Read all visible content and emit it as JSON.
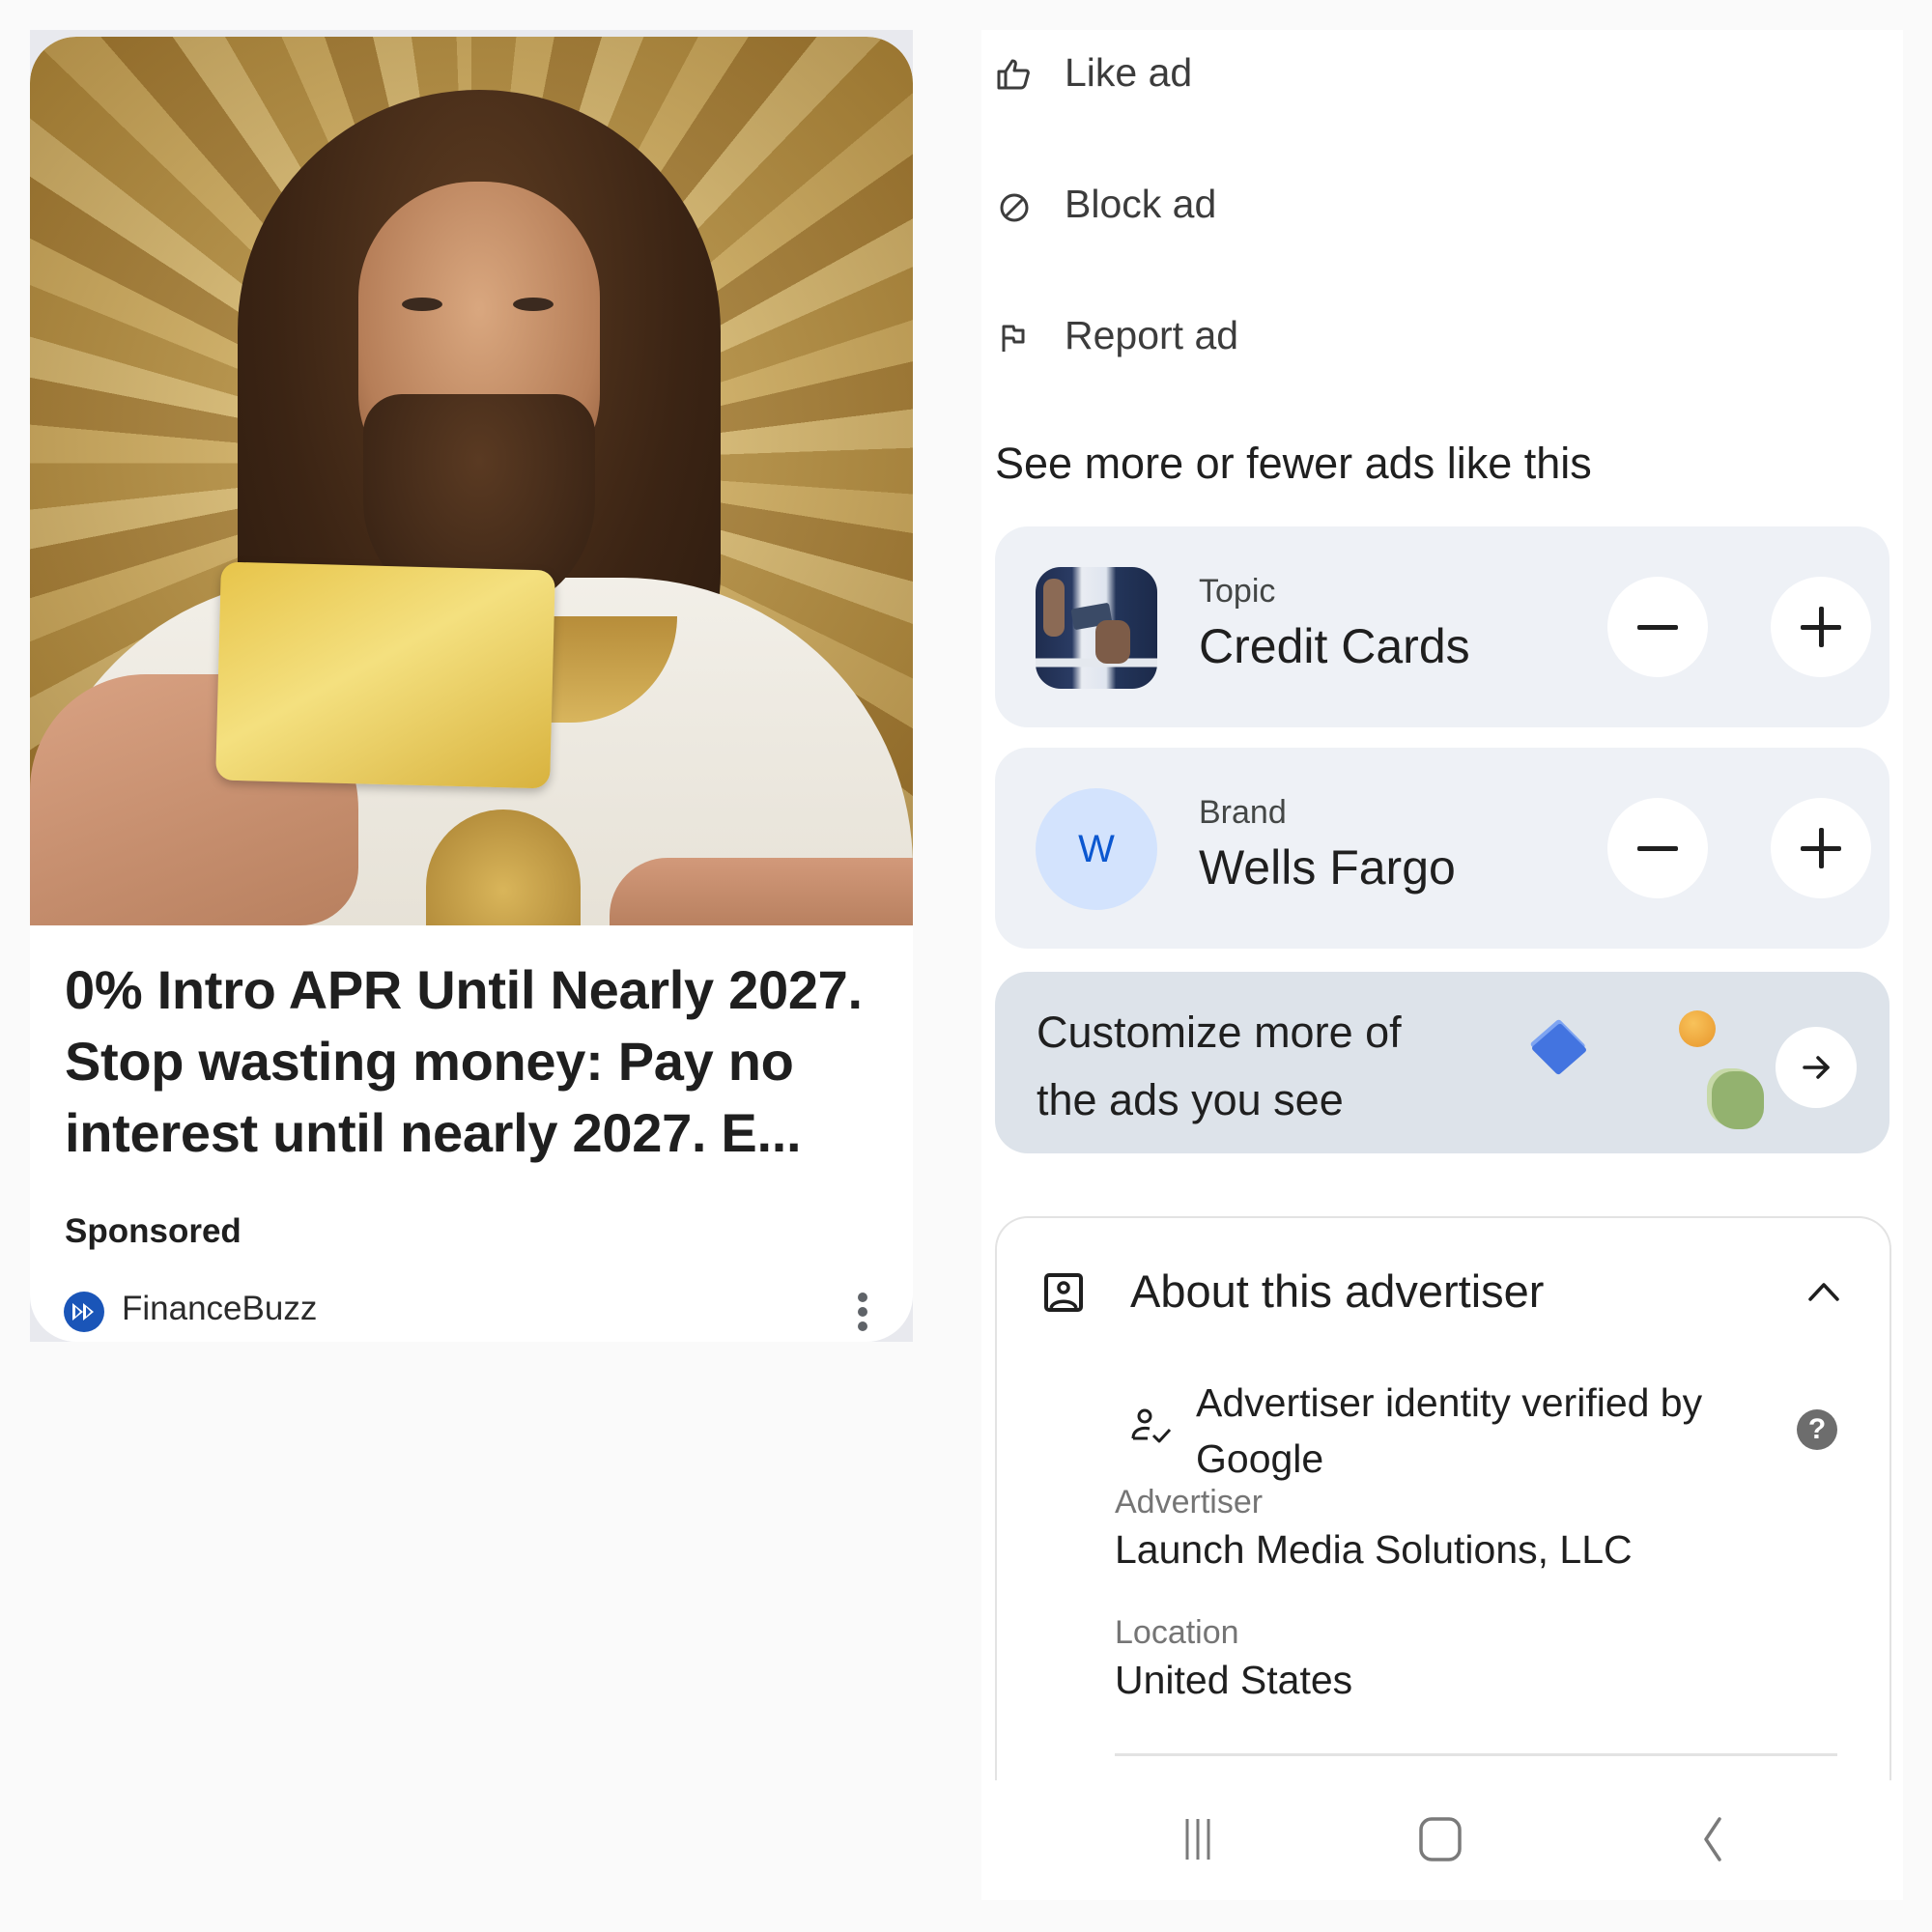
{
  "ad": {
    "image_alt": "Bearded man in white robe holding a gold credit card before a golden background",
    "headline": "0% Intro APR Until Nearly 2027. Stop wasting money: Pay no interest until nearly 2027. E...",
    "sponsored_label": "Sponsored",
    "advertiser_name": "FinanceBuzz",
    "logo_icon": "fast-forward-icon",
    "menu_icon": "more-vert-icon"
  },
  "actions": [
    {
      "label": "Like ad",
      "icon": "thumb-up-icon"
    },
    {
      "label": "Block ad",
      "icon": "block-icon"
    },
    {
      "label": "Report ad",
      "icon": "flag-icon"
    }
  ],
  "preferences": {
    "heading": "See more or fewer ads like this",
    "items": [
      {
        "kind": "Topic",
        "name": "Credit Cards",
        "thumb": "credit-card-photo"
      },
      {
        "kind": "Brand",
        "name": "Wells Fargo",
        "initial": "W"
      }
    ],
    "decrease_symbol": "minus-icon",
    "increase_symbol": "plus-icon"
  },
  "customize": {
    "text": "Customize more of the ads you see",
    "arrow_icon": "arrow-right-icon",
    "colors": {
      "diamond": "#4374e0",
      "circle": "#f0a53a",
      "blob": "#93b26f"
    }
  },
  "about": {
    "title": "About this advertiser",
    "expanded": true,
    "verified_text": "Advertiser identity verified by Google",
    "help_symbol": "?",
    "fields": [
      {
        "label": "Advertiser",
        "value": "Launch Media Solutions, LLC"
      },
      {
        "label": "Location",
        "value": "United States"
      }
    ]
  },
  "nav": {
    "recents_icon": "recents-icon",
    "home_icon": "home-icon",
    "back_icon": "back-icon"
  },
  "colors": {
    "accent_blue": "#0b57d0",
    "card_bg": "#eef1f6",
    "customize_bg": "#dde3ea",
    "brand_avatar_bg": "#d3e3fd",
    "financebuzz_blue": "#1a55b8"
  }
}
